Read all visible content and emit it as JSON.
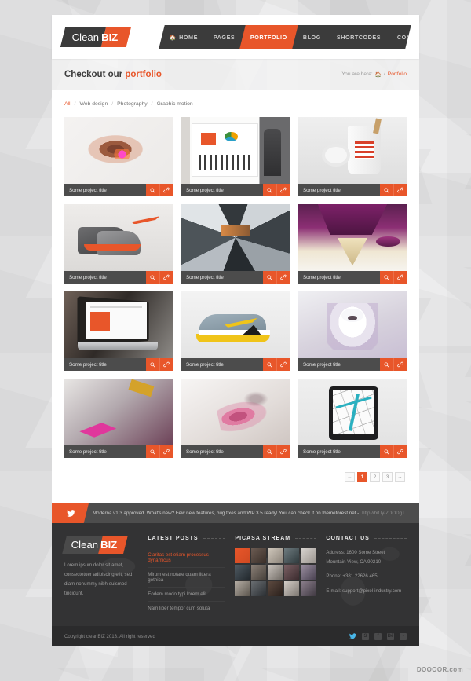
{
  "header": {
    "logo": {
      "word_a": "Clean",
      "word_b": "BIZ"
    },
    "nav": [
      {
        "label": "HOME",
        "icon": "home-icon",
        "active": false
      },
      {
        "label": "PAGES",
        "active": false
      },
      {
        "label": "PORTFOLIO",
        "active": true
      },
      {
        "label": "BLOG",
        "active": false
      },
      {
        "label": "SHORTCODES",
        "active": false
      },
      {
        "label": "CONTACT",
        "active": false
      }
    ],
    "search_icon": "search-icon"
  },
  "title_bar": {
    "title_plain": "Checkout our",
    "title_accent": "portfolio",
    "breadcrumb_prefix": "You are here:",
    "breadcrumb_home_icon": "home-icon",
    "breadcrumb_sep": "/",
    "breadcrumb_current": "Portfolio"
  },
  "filters": [
    {
      "label": "All",
      "active": true
    },
    {
      "label": "Web design",
      "active": false
    },
    {
      "label": "Photography",
      "active": false
    },
    {
      "label": "Graphic motion",
      "active": false
    }
  ],
  "portfolio": {
    "item_title": "Some project title",
    "zoom_icon": "search-icon",
    "link_icon": "link-icon",
    "items": [
      {
        "title": "Some project title",
        "theme": "abstract-brown-splash"
      },
      {
        "title": "Some project title",
        "theme": "infographic-poster-man"
      },
      {
        "title": "Some project title",
        "theme": "paper-coffee-cup"
      },
      {
        "title": "Some project title",
        "theme": "orange-nike-sneakers"
      },
      {
        "title": "Some project title",
        "theme": "geometric-photo-collage"
      },
      {
        "title": "Some project title",
        "theme": "purple-inverted-pyramid"
      },
      {
        "title": "Some project title",
        "theme": "laptop-html5-website"
      },
      {
        "title": "Some project title",
        "theme": "yellow-grey-sneaker"
      },
      {
        "title": "Some project title",
        "theme": "polar-bear-splash"
      },
      {
        "title": "Some project title",
        "theme": "magenta-polygon-cube"
      },
      {
        "title": "Some project title",
        "theme": "pink-smoke-dancer"
      },
      {
        "title": "Some project title",
        "theme": "tablet-blueprint-lines"
      }
    ]
  },
  "pagination": {
    "prev_label": "←",
    "next_label": "→",
    "pages": [
      {
        "label": "1",
        "active": true
      },
      {
        "label": "2",
        "active": false
      },
      {
        "label": "3",
        "active": false
      }
    ]
  },
  "tweet_bar": {
    "icon": "twitter-icon",
    "text": "Moderna v1.3 approved. What's new? Few new features, bug fixes and WP 3.5 ready! You can check it on themeforest.net -",
    "link": "http://bit.ly/ZDODgT"
  },
  "footer": {
    "about": {
      "logo": {
        "word_a": "Clean",
        "word_b": "BIZ"
      },
      "text": "Lorem ipsum dolor sit amet, consectetuer adipiscing elit, sed diam nonummy nibh euismod tincidunt."
    },
    "latest_posts": {
      "heading": "LATEST POSTS",
      "items": [
        {
          "label": "Claritas est etiam processus dynamicus",
          "active": true
        },
        {
          "label": "Mirum est notare quam littera gothica",
          "active": false
        },
        {
          "label": "Eodem modo typi lorem elit",
          "active": false
        },
        {
          "label": "Nam liber tempor cum soluta",
          "active": false
        }
      ]
    },
    "picasa": {
      "heading": "PICASA  STREAM",
      "thumb_count": 15
    },
    "contact": {
      "heading": "CONTACT US",
      "address_line1": "Address: 1600 Some Street",
      "address_line2": "Mountain View, CA 90210",
      "phone": "Phone: +381 22626 465",
      "email": "E-mail:  support@pixel-industry.com"
    }
  },
  "copyright": {
    "text": "Copyright cleanBIZ 2013. All right reserved",
    "socials": [
      {
        "name": "twitter-icon",
        "glyph": "✈",
        "highlight": true
      },
      {
        "name": "skype-icon",
        "glyph": "S",
        "highlight": false
      },
      {
        "name": "facebook-icon",
        "glyph": "f",
        "highlight": false
      },
      {
        "name": "behance-icon",
        "glyph": "Bē",
        "highlight": false
      },
      {
        "name": "rss-icon",
        "glyph": "◔",
        "highlight": false
      }
    ]
  },
  "watermark": {
    "text": "DOOOOR.com"
  }
}
